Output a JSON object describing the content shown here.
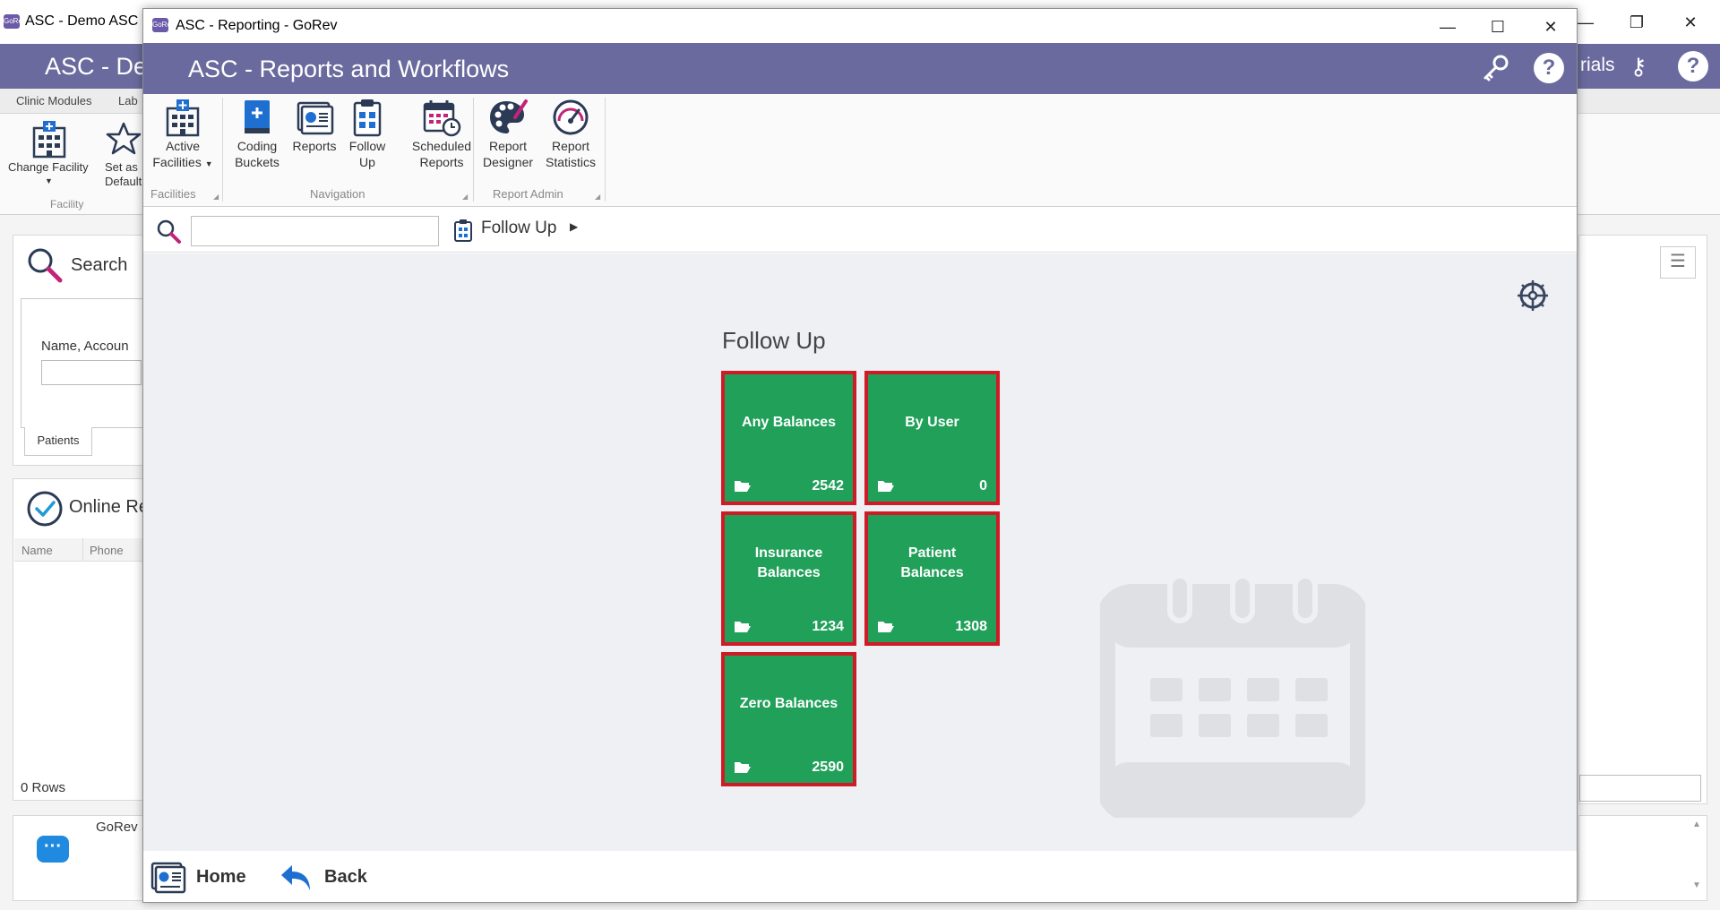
{
  "background_window": {
    "title": "ASC - Demo ASC - H",
    "app_icon_text": "GoRev",
    "header_title": "ASC - Der",
    "header_right_text": "rials",
    "tabs": [
      "Clinic Modules",
      "Lab"
    ],
    "ribbon": {
      "change_facility_label": "Change Facility",
      "set_as_default_label": "Set as Default",
      "group_label": "Facility"
    },
    "search_panel": {
      "title": "Search",
      "name_label": "Name, Accoun",
      "tab_label": "Patients"
    },
    "online_panel": {
      "title": "Online Re",
      "columns": [
        "Name",
        "Phone"
      ],
      "rows_text": "0 Rows"
    },
    "chat_panel": {
      "label": "GoRev S"
    }
  },
  "dialog": {
    "window_title": "ASC - Reporting - GoRev",
    "app_icon_text": "GoRev",
    "header_title": "ASC - Reports and Workflows",
    "ribbon": {
      "groups": [
        {
          "label": "Facilities",
          "buttons": [
            {
              "label_line1": "Active",
              "label_line2": "Facilities"
            }
          ]
        },
        {
          "label": "Navigation",
          "buttons": [
            {
              "label_line1": "Coding",
              "label_line2": "Buckets"
            },
            {
              "label_line1": "Reports",
              "label_line2": ""
            },
            {
              "label_line1": "Follow",
              "label_line2": "Up"
            },
            {
              "label_line1": "Scheduled",
              "label_line2": "Reports"
            }
          ]
        },
        {
          "label": "Report Admin",
          "buttons": [
            {
              "label_line1": "Report",
              "label_line2": "Designer"
            },
            {
              "label_line1": "Report",
              "label_line2": "Statistics"
            }
          ]
        }
      ]
    },
    "search": {
      "value": "",
      "placeholder": ""
    },
    "breadcrumb": {
      "label": "Follow Up"
    },
    "content": {
      "title": "Follow Up",
      "tiles": [
        {
          "name": "Any Balances",
          "count": "2542"
        },
        {
          "name": "By User",
          "count": "0"
        },
        {
          "name": "Insurance Balances",
          "count": "1234"
        },
        {
          "name": "Patient Balances",
          "count": "1308"
        },
        {
          "name": "Zero Balances",
          "count": "2590"
        }
      ]
    },
    "footer": {
      "home_label": "Home",
      "back_label": "Back"
    }
  },
  "colors": {
    "header_bg": "#6a6a9e",
    "tile_bg": "#21a05a",
    "tile_border": "#d01a25",
    "content_bg": "#eef0f4"
  }
}
